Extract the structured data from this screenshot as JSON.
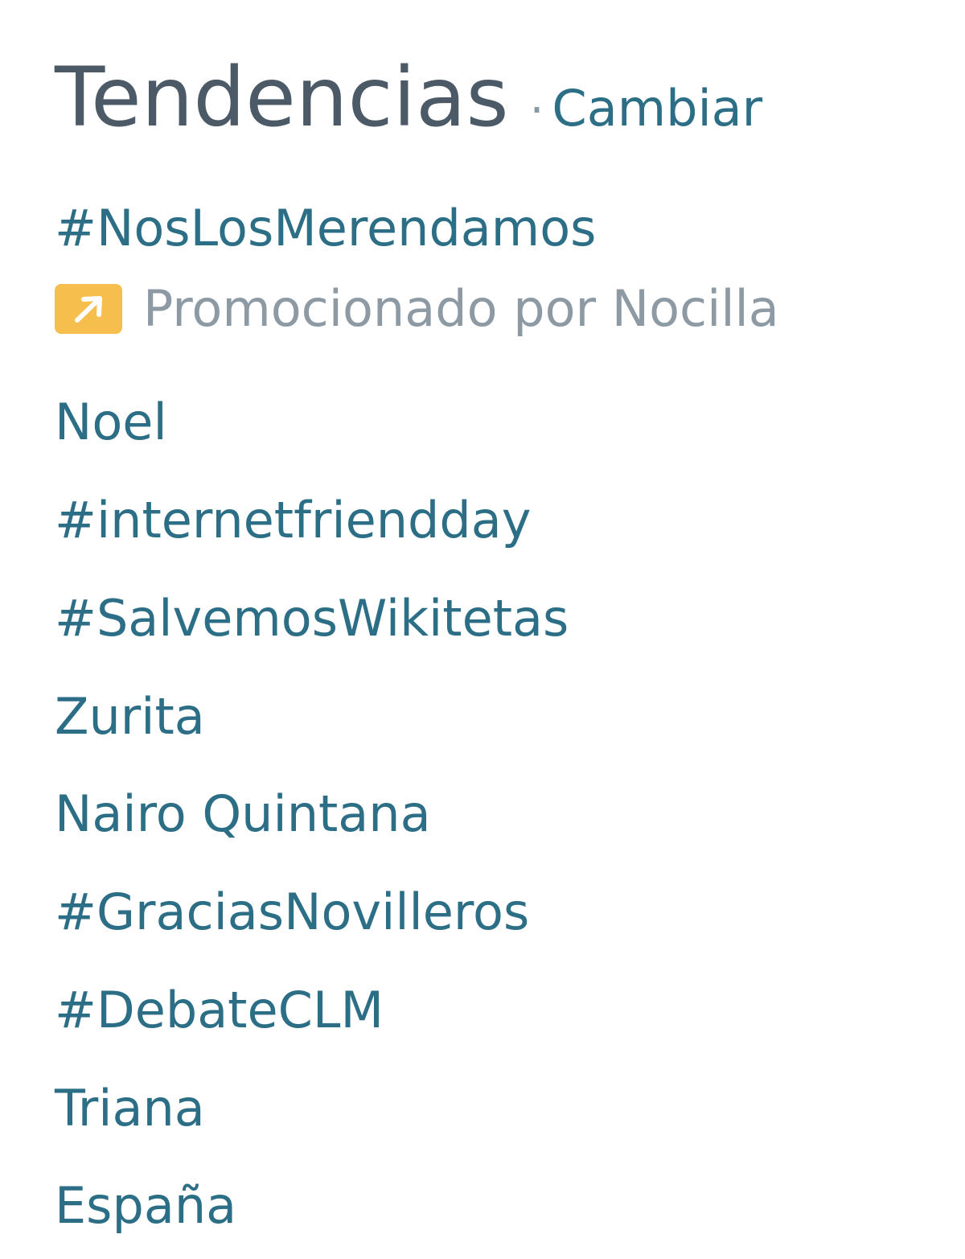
{
  "header": {
    "title": "Tendencias",
    "separator": "·",
    "change_label": "Cambiar"
  },
  "promoted": {
    "hashtag": "#NosLosMerendamos",
    "icon": "promoted-arrow-icon",
    "label": "Promocionado por Nocilla",
    "badge_color": "#f6be4d"
  },
  "trends": [
    "Noel",
    "#internetfriendday",
    "#SalvemosWikitetas",
    "Zurita",
    "Nairo Quintana",
    "#GraciasNovilleros",
    "#DebateCLM",
    "Triana",
    "España"
  ],
  "colors": {
    "title": "#4b5a66",
    "link": "#2b6e86",
    "muted": "#8d9aa4"
  }
}
